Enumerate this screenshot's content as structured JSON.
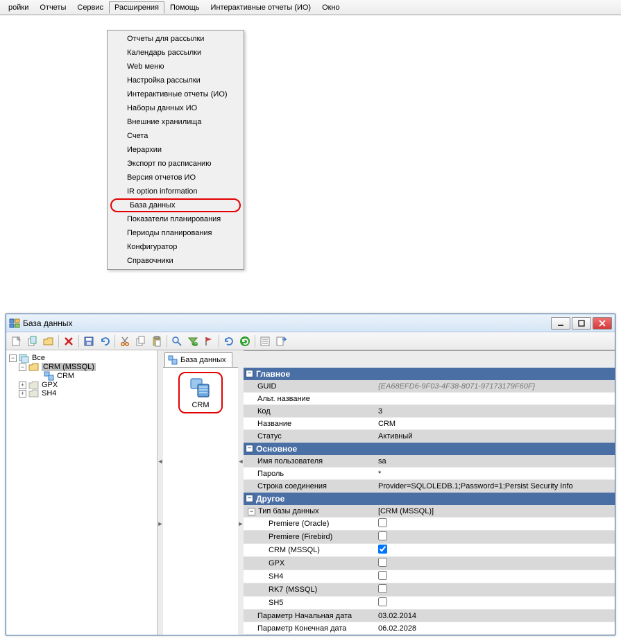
{
  "menubar": [
    {
      "label": "ройки",
      "u": 0
    },
    {
      "label": "Отчеты",
      "u": 0
    },
    {
      "label": "Сервис",
      "u": 0
    },
    {
      "label": "Расширения",
      "u": 3
    },
    {
      "label": "Помощь",
      "u": 0
    },
    {
      "label": "Интерактивные отчеты (ИО)",
      "u": -1
    },
    {
      "label": "Окно",
      "u": 1
    }
  ],
  "dropdown": {
    "items": [
      "Отчеты для рассылки",
      "Календарь рассылки",
      "Web меню",
      "Настройка рассылки",
      "Интерактивные отчеты (ИО)",
      "Наборы данных ИО",
      "Внешние хранилища",
      "Счета",
      "Иерархии",
      "Экспорт по расписанию",
      "Версия отчетов ИО",
      "IR option information",
      "База данных",
      "Показатели планирования",
      "Периоды планирования",
      "Конфигуратор",
      "Справочники"
    ],
    "highlighted_index": 12
  },
  "window": {
    "title": "База данных",
    "tab_label": "База данных",
    "tree": {
      "root": "Все",
      "nodes": [
        {
          "label": "CRM (MSSQL)",
          "expanded": true,
          "selected": true,
          "children": [
            {
              "label": "CRM"
            }
          ]
        },
        {
          "label": "GPX",
          "expanded": false
        },
        {
          "label": "SH4",
          "expanded": false
        }
      ]
    },
    "item_label": "CRM",
    "sections": {
      "main": {
        "title": "Главное",
        "rows": [
          {
            "k": "GUID",
            "v": "{EA68EFD6-9F03-4F38-8071-97173179F60F}",
            "guid": true
          },
          {
            "k": "Альт. название",
            "v": ""
          },
          {
            "k": "Код",
            "v": "3"
          },
          {
            "k": "Название",
            "v": "CRM"
          },
          {
            "k": "Статус",
            "v": "Активный"
          }
        ]
      },
      "primary": {
        "title": "Основное",
        "rows": [
          {
            "k": "Имя пользователя",
            "v": "sa"
          },
          {
            "k": "Пароль",
            "v": "*"
          },
          {
            "k": "Строка соединения",
            "v": "Provider=SQLOLEDB.1;Password=1;Persist Security Info"
          }
        ]
      },
      "other": {
        "title": "Другое",
        "dbtype_label": "Тип базы данных",
        "dbtype_value": "[CRM (MSSQL)]",
        "dbtypes": [
          {
            "k": "Premiere (Oracle)",
            "c": false
          },
          {
            "k": "Premiere (Firebird)",
            "c": false
          },
          {
            "k": "CRM (MSSQL)",
            "c": true
          },
          {
            "k": "GPX",
            "c": false
          },
          {
            "k": "SH4",
            "c": false
          },
          {
            "k": "RK7 (MSSQL)",
            "c": false
          },
          {
            "k": "SH5",
            "c": false
          }
        ],
        "params": [
          {
            "k": "Параметр Начальная дата",
            "v": "03.02.2014"
          },
          {
            "k": "Параметр Конечная дата",
            "v": "06.02.2028"
          }
        ]
      }
    }
  }
}
